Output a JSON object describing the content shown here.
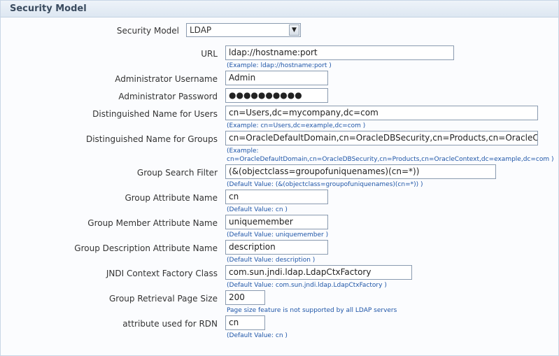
{
  "section": {
    "title": "Security Model"
  },
  "security_model": {
    "label": "Security Model",
    "selected": "LDAP"
  },
  "url": {
    "label": "URL",
    "value": "ldap://hostname:port",
    "hint": "(Example: ldap://hostname:port )"
  },
  "admin_username": {
    "label": "Administrator Username",
    "value": "Admin"
  },
  "admin_password": {
    "label": "Administrator Password",
    "value": "●●●●●●●●●●"
  },
  "dn_users": {
    "label": "Distinguished Name for Users",
    "value": "cn=Users,dc=mycompany,dc=com",
    "hint": "(Example: cn=Users,dc=example,dc=com )"
  },
  "dn_groups": {
    "label": "Distinguished Name for Groups",
    "value": "cn=OracleDefaultDomain,cn=OracleDBSecurity,cn=Products,cn=OracleContext",
    "hint_line1": "(Example:",
    "hint_line2": "cn=OracleDefaultDomain,cn=OracleDBSecurity,cn=Products,cn=OracleContext,dc=example,dc=com )"
  },
  "group_search_filter": {
    "label": "Group Search Filter",
    "value": "(&(objectclass=groupofuniquenames)(cn=*))",
    "hint": "(Default Value: (&(objectclass=groupofuniquenames)(cn=*)) )"
  },
  "group_attribute_name": {
    "label": "Group Attribute Name",
    "value": "cn",
    "hint": "(Default Value: cn )"
  },
  "group_member_attribute_name": {
    "label": "Group Member Attribute Name",
    "value": "uniquemember",
    "hint": "(Default Value: uniquemember )"
  },
  "group_description_attribute_name": {
    "label": "Group Description Attribute Name",
    "value": "description",
    "hint": "(Default Value: description )"
  },
  "jndi_context_factory_class": {
    "label": "JNDI Context Factory Class",
    "value": "com.sun.jndi.ldap.LdapCtxFactory",
    "hint": "(Default Value: com.sun.jndi.ldap.LdapCtxFactory )"
  },
  "group_retrieval_page_size": {
    "label": "Group Retrieval Page Size",
    "value": "200",
    "hint": "Page size feature is not supported by all LDAP servers"
  },
  "attribute_rdn": {
    "label": "attribute used for RDN",
    "value": "cn",
    "hint": "(Default Value: cn )"
  }
}
